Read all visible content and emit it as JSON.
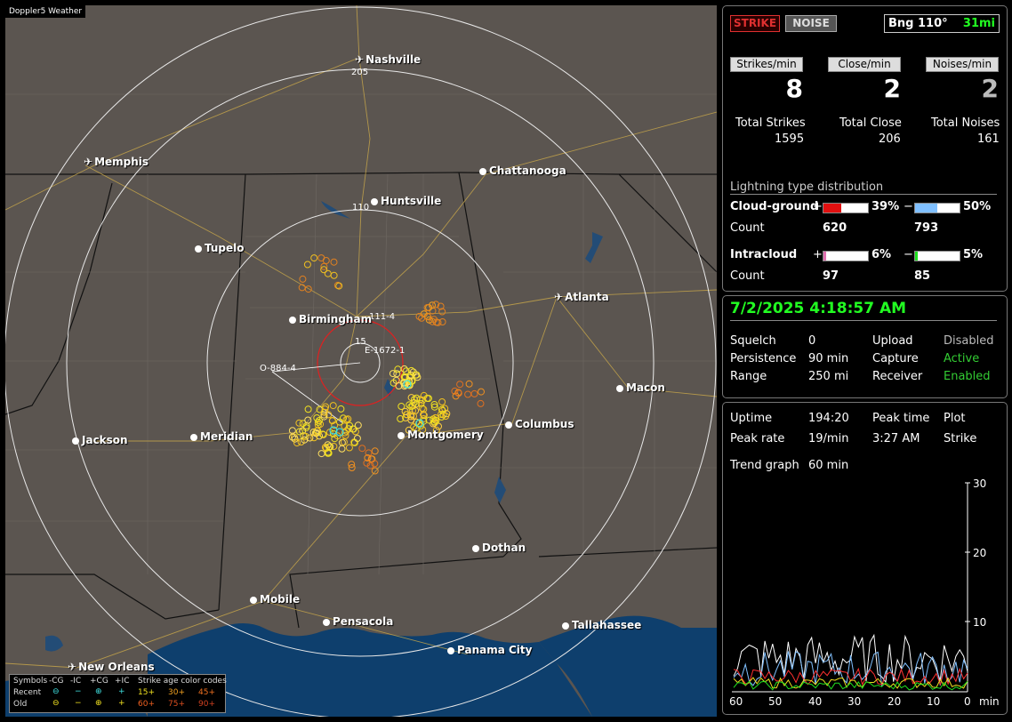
{
  "window_title": "Doppler5 Weather",
  "map": {
    "cities": [
      {
        "name": "Nashville",
        "icon": "airport-icon"
      },
      {
        "name": "Memphis",
        "icon": "airport-icon"
      },
      {
        "name": "Chattanooga",
        "icon": "city-dot-icon"
      },
      {
        "name": "Huntsville",
        "icon": "city-dot-icon"
      },
      {
        "name": "Tupelo",
        "icon": "city-dot-icon"
      },
      {
        "name": "Atlanta",
        "icon": "airport-icon"
      },
      {
        "name": "Birmingham",
        "icon": "city-dot-icon"
      },
      {
        "name": "Macon",
        "icon": "city-dot-icon"
      },
      {
        "name": "Columbus",
        "icon": "city-dot-icon"
      },
      {
        "name": "Jackson",
        "icon": "city-dot-icon"
      },
      {
        "name": "Meridian",
        "icon": "city-dot-icon"
      },
      {
        "name": "Montgomery",
        "icon": "city-dot-icon"
      },
      {
        "name": "Dothan",
        "icon": "city-dot-icon"
      },
      {
        "name": "Mobile",
        "icon": "city-dot-icon"
      },
      {
        "name": "Pensacola",
        "icon": "city-dot-icon"
      },
      {
        "name": "Tallahassee",
        "icon": "city-dot-icon"
      },
      {
        "name": "Panama City",
        "icon": "city-dot-icon"
      },
      {
        "name": "New Orleans",
        "icon": "airport-icon"
      }
    ],
    "range_labels": [
      "205",
      "110",
      "15"
    ],
    "annotations": [
      "111-4",
      "E-1672-1",
      "O-884-4"
    ]
  },
  "legend": {
    "header": [
      "Symbols",
      "-CG",
      "-IC",
      "+CG",
      "+IC",
      "Strike age color codes"
    ],
    "recent_label": "Recent",
    "old_label": "Old",
    "recent_ages": [
      "15+",
      "30+",
      "45+"
    ],
    "old_ages": [
      "60+",
      "75+",
      "90+"
    ]
  },
  "top": {
    "strike_btn": "STRIKE",
    "noise_btn": "NOISE",
    "bearing": "Bng 110°",
    "distance": "31mi",
    "strikes_min_label": "Strikes/min",
    "close_min_label": "Close/min",
    "noises_min_label": "Noises/min",
    "strikes_min": "8",
    "close_min": "2",
    "noises_min": "2",
    "total_strikes_label": "Total Strikes",
    "total_close_label": "Total Close",
    "total_noises_label": "Total Noises",
    "total_strikes": "1595",
    "total_close": "206",
    "total_noises": "161",
    "dist_title": "Lightning type distribution",
    "cg_label": "Cloud-ground",
    "ic_label": "Intracloud",
    "count_label": "Count",
    "plus": "+",
    "minus": "−",
    "cg_plus_pct": "39%",
    "cg_minus_pct": "50%",
    "cg_plus_count": "620",
    "cg_minus_count": "793",
    "ic_plus_pct": "6%",
    "ic_minus_pct": "5%",
    "ic_plus_count": "97",
    "ic_minus_count": "85",
    "cg_plus_frac": 0.39,
    "cg_minus_frac": 0.5,
    "ic_plus_frac": 0.06,
    "ic_minus_frac": 0.05
  },
  "status": {
    "datetime": "7/2/2025 4:18:57 AM",
    "squelch_label": "Squelch",
    "squelch": "0",
    "persistence_label": "Persistence",
    "persistence": "90 min",
    "range_label": "Range",
    "range": "250 mi",
    "upload_label": "Upload",
    "upload": "Disabled",
    "capture_label": "Capture",
    "capture": "Active",
    "receiver_label": "Receiver",
    "receiver": "Enabled"
  },
  "trend": {
    "uptime_label": "Uptime",
    "uptime": "194:20",
    "peak_time_label": "Peak time",
    "peak_time": "3:27 AM",
    "plot_label": "Plot",
    "plot": "Strike",
    "peak_rate_label": "Peak rate",
    "peak_rate": "19/min",
    "trend_graph_label": "Trend graph",
    "trend_graph": "60 min",
    "y_ticks": [
      "30",
      "20",
      "10",
      "0"
    ],
    "x_ticks": [
      "60",
      "50",
      "40",
      "30",
      "20",
      "10",
      "0"
    ],
    "x_unit": "min"
  },
  "colors": {
    "accent_green": "#00ff00",
    "strike_red": "#ff2020",
    "cg_minus_blue": "#80c0ff",
    "ic_plus_pink": "#e070b0",
    "ic_minus_green": "#20e020"
  }
}
